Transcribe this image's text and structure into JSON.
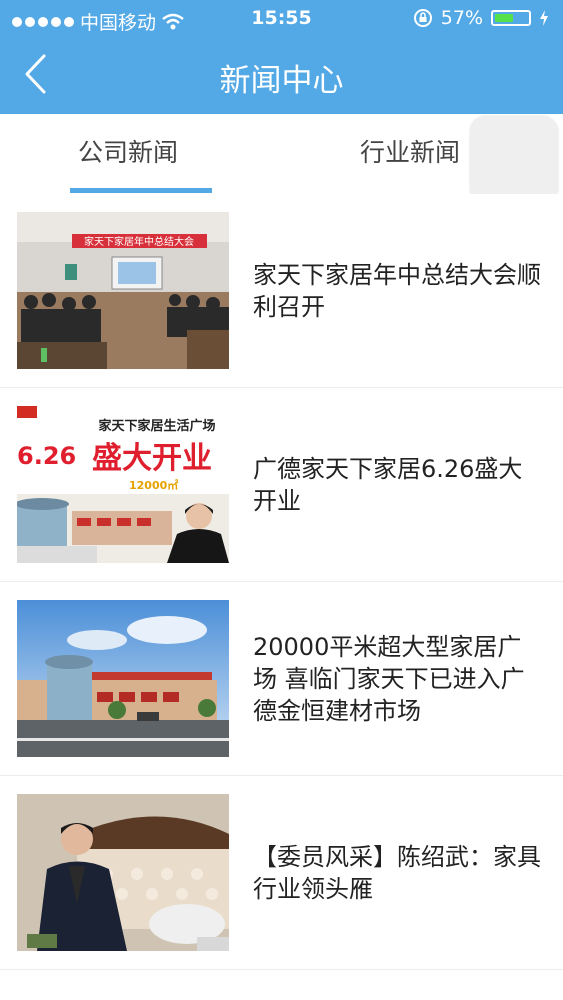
{
  "status_bar": {
    "carrier": "中国移动",
    "time": "15:55",
    "battery": "57%",
    "battery_level": 0.57
  },
  "nav": {
    "title": "新闻中心"
  },
  "tabs": [
    {
      "label": "公司新闻",
      "active": true
    },
    {
      "label": "行业新闻",
      "active": false
    }
  ],
  "news": [
    {
      "title": "家天下家居年中总结大会顺利召开",
      "banner": "家天下家居年中总结大会"
    },
    {
      "title": "广德家天下家居6.26盛大开业",
      "ad_header": "家天下家居生活广场",
      "ad_date": "6.26",
      "ad_headline": "盛大开业",
      "ad_area": "12000㎡"
    },
    {
      "title": "20000平米超大型家居广场  喜临门家天下已进入广德金恒建材市场"
    },
    {
      "title": "【委员风采】陈绍武：家具行业领头雁"
    }
  ],
  "colors": {
    "header": "#53a8e6",
    "accent": "#53a8e6",
    "battery": "#56e04a"
  }
}
